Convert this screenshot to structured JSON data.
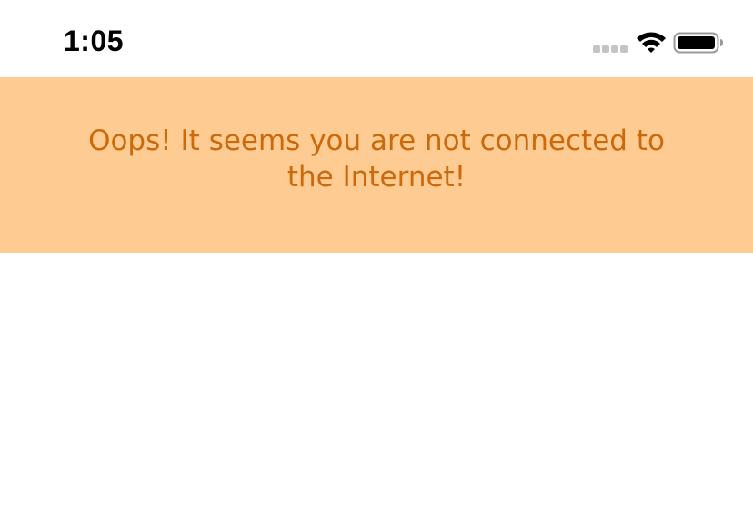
{
  "status_bar": {
    "time": "1:05",
    "icons": [
      "cellular-signal-icon",
      "wifi-icon",
      "battery-icon"
    ]
  },
  "banner": {
    "message": "Oops! It seems you are not connected to the Internet!",
    "background_color": "#fecc93",
    "text_color": "#cc6a0b"
  }
}
